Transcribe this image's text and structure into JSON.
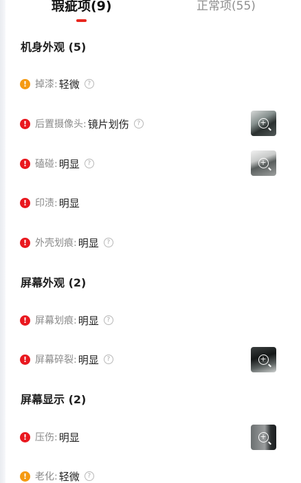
{
  "colors": {
    "accent": "#e8271f",
    "severe": "#e9181f",
    "minor": "#f59a12"
  },
  "tabs": [
    {
      "label": "瑕疵项(9)"
    },
    {
      "label": "正常项(55)"
    }
  ],
  "sections": [
    {
      "title": "机身外观 (5)"
    },
    {
      "title": "屏幕外观 (2)"
    },
    {
      "title": "屏幕显示 (2)"
    }
  ],
  "items": [
    {
      "name": "掉漆:",
      "level": "轻微",
      "severity": "minor",
      "icon": "exclamation-icon",
      "help": "?"
    },
    {
      "name": "后置摄像头:",
      "level": "镜片划伤",
      "severity": "severe",
      "icon": "exclamation-icon",
      "help": "?"
    },
    {
      "name": "磕碰:",
      "level": "明显",
      "severity": "severe",
      "icon": "exclamation-icon",
      "help": "?"
    },
    {
      "name": "印渍:",
      "level": "明显",
      "severity": "severe",
      "icon": "exclamation-icon"
    },
    {
      "name": "外壳划痕:",
      "level": "明显",
      "severity": "severe",
      "icon": "exclamation-icon",
      "help": "?"
    },
    {
      "name": "屏幕划痕:",
      "level": "明显",
      "severity": "severe",
      "icon": "exclamation-icon",
      "help": "?"
    },
    {
      "name": "屏幕碎裂:",
      "level": "明显",
      "severity": "severe",
      "icon": "exclamation-icon",
      "help": "?"
    },
    {
      "name": "压伤:",
      "level": "明显",
      "severity": "severe",
      "icon": "exclamation-icon"
    },
    {
      "name": "老化:",
      "level": "轻微",
      "severity": "minor",
      "icon": "exclamation-icon",
      "help": "?"
    }
  ],
  "thumbnail_icon": "zoom-in-icon",
  "zoom_symbol": "+",
  "status_symbol": "!"
}
